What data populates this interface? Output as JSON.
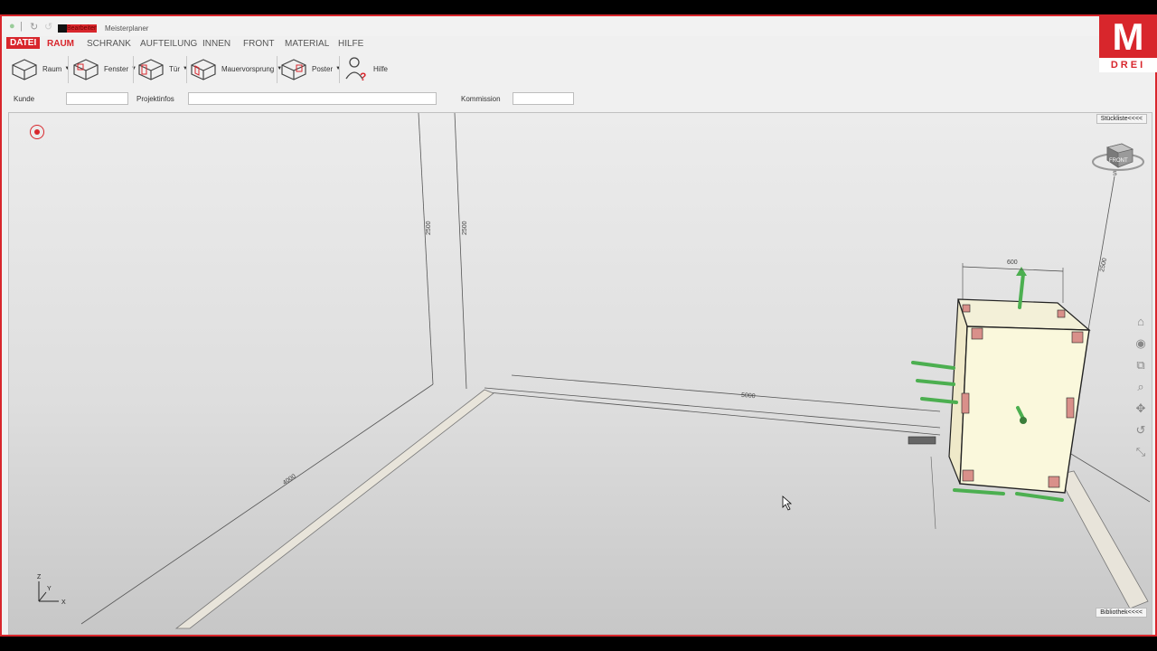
{
  "titlebar": {
    "doc_label": "Bearbeiten",
    "app_title": "Meisterplaner"
  },
  "menu": {
    "file": "DATEI",
    "items": [
      "RAUM",
      "SCHRANK",
      "AUFTEILUNG",
      "INNEN",
      "FRONT",
      "MATERIAL",
      "HILFE"
    ]
  },
  "ribbon": {
    "room": "Raum",
    "window": "Fenster",
    "door": "Tür",
    "wall_projection": "Mauervorsprung",
    "poster": "Poster",
    "help": "Hilfe"
  },
  "fields": {
    "customer_label": "Kunde",
    "customer_value": "",
    "project_label": "Projektinfos",
    "project_value": "",
    "commission_label": "Kommission",
    "commission_value": ""
  },
  "logo": {
    "letter": "M",
    "word": "DREI"
  },
  "panels": {
    "parts_list": "Stückliste<<<<",
    "library": "Bibliothek<<<<"
  },
  "viewcube": {
    "face": "FRONT",
    "compass": "S"
  },
  "dimensions": {
    "wall_height_1": "2500",
    "wall_height_2": "2500",
    "cabinet_width": "600",
    "right_height": "2500",
    "wall_length": "5000",
    "floor_length": "4000"
  },
  "axes": {
    "z": "Z",
    "y": "Y",
    "x": "X"
  },
  "colors": {
    "accent": "#d8262c",
    "cabinet_face": "#faf8dc",
    "handle_green": "#4caf50",
    "corner_pink": "#d9908a"
  },
  "icons": [
    "home-icon",
    "orbit-icon",
    "zoom-extents-icon",
    "zoom-icon",
    "pan-icon",
    "rotate-icon",
    "fullscreen-icon"
  ]
}
